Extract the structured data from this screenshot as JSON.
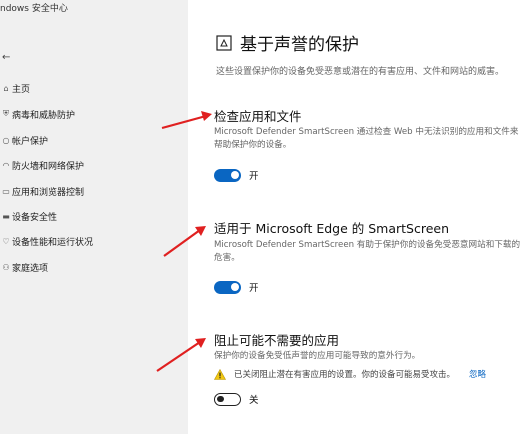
{
  "window": {
    "title": "ndows 安全中心"
  },
  "sidebar": {
    "back_glyph": "←",
    "items": [
      {
        "label": "主页",
        "icon": "home-icon"
      },
      {
        "label": "病毒和威胁防护",
        "icon": "shield-icon"
      },
      {
        "label": "帐户保护",
        "icon": "person-icon"
      },
      {
        "label": "防火墙和网络保护",
        "icon": "wifi-icon"
      },
      {
        "label": "应用和浏览器控制",
        "icon": "browser-icon"
      },
      {
        "label": "设备安全性",
        "icon": "laptop-icon"
      },
      {
        "label": "设备性能和运行状况",
        "icon": "heart-icon"
      },
      {
        "label": "家庭选项",
        "icon": "family-icon"
      }
    ]
  },
  "main": {
    "title": "基于声誉的保护",
    "description": "这些设置保护你的设备免受恶意或潜在的有害应用、文件和网站的威害。",
    "sections": [
      {
        "title": "检查应用和文件",
        "description": "Microsoft Defender SmartScreen 通过检查 Web 中无法识别的应用和文件来帮助保护你的设备。",
        "toggle_label": "开",
        "toggle_on": true
      },
      {
        "title": "适用于 Microsoft Edge 的 SmartScreen",
        "description": "Microsoft Defender SmartScreen 有助于保护你的设备免受恶意网站和下载的危害。",
        "toggle_label": "开",
        "toggle_on": true
      },
      {
        "title": "阻止可能不需要的应用",
        "description": "保护你的设备免受低声誉的应用可能导致的意外行为。",
        "warning": "已关闭阻止潜在有害应用的设置。你的设备可能易受攻击。",
        "warning_link": "忽略",
        "toggle_label": "关",
        "toggle_on": false
      }
    ]
  },
  "colors": {
    "accent": "#0a66c2",
    "arrow": "#e02020",
    "sidebar_bg": "#f0f0f0"
  }
}
